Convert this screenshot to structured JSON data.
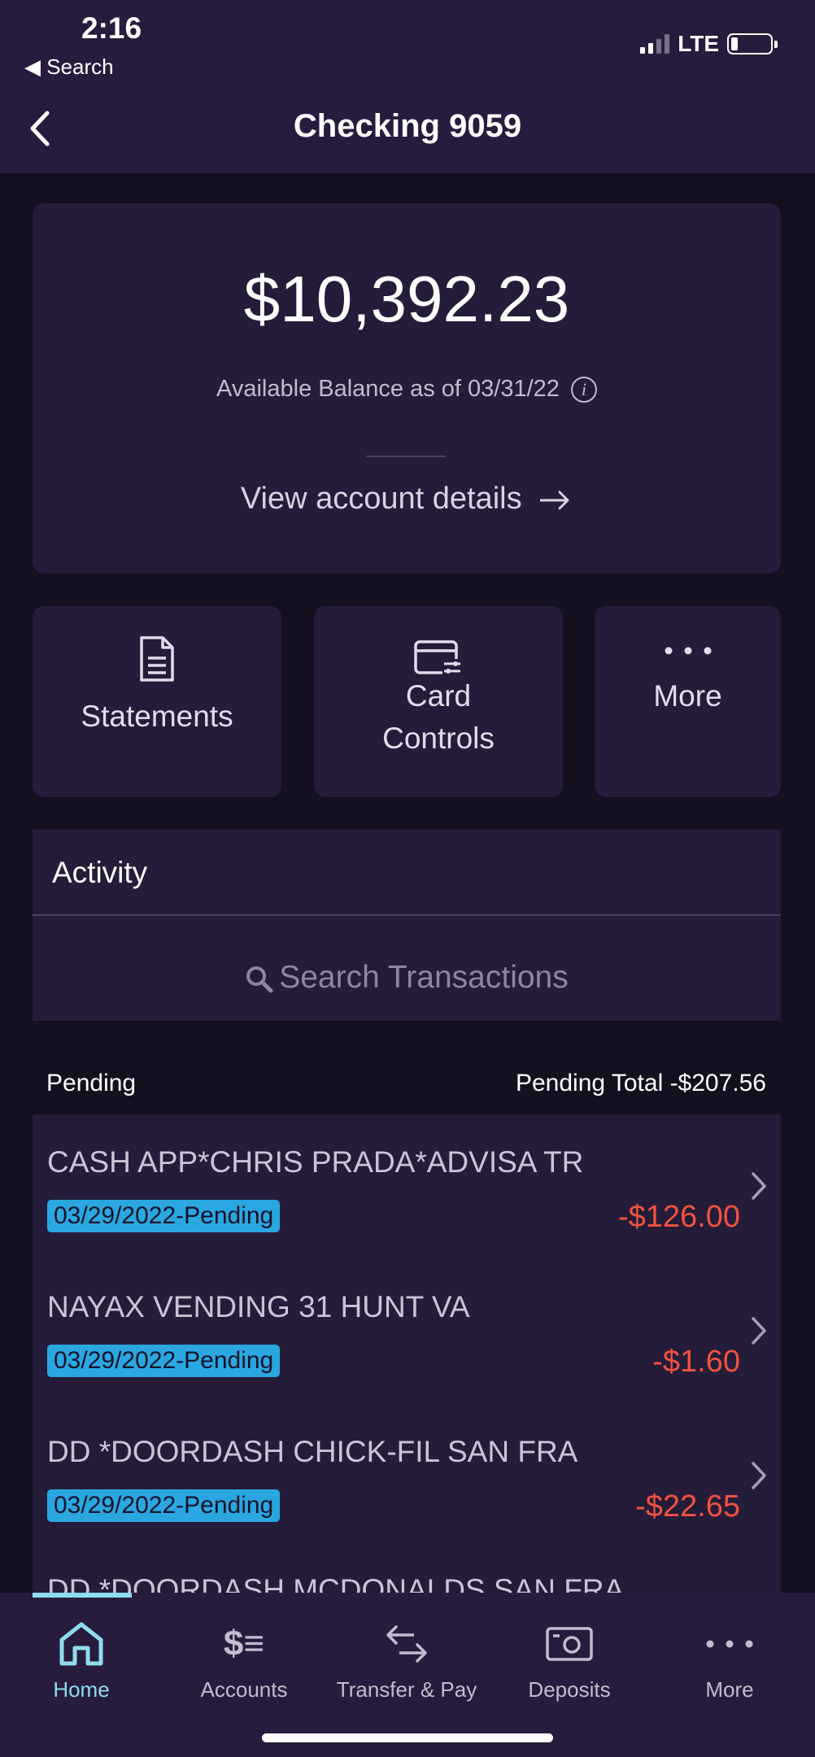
{
  "status_bar": {
    "time": "2:16",
    "back_app": "Search",
    "network": "LTE"
  },
  "nav": {
    "title": "Checking 9059"
  },
  "balance": {
    "amount": "$10,392.23",
    "label": "Available Balance as of 03/31/22",
    "details_link": "View account details"
  },
  "actions": {
    "statements": "Statements",
    "card_controls_line1": "Card",
    "card_controls_line2": "Controls",
    "more": "More"
  },
  "activity": {
    "title": "Activity",
    "search_placeholder": "Search Transactions",
    "pending_label": "Pending",
    "pending_total": "Pending Total -$207.56"
  },
  "transactions": [
    {
      "name": "CASH APP*CHRIS PRADA*ADVISA TR",
      "date": "03/29/2022-Pending",
      "amount": "-$126.00"
    },
    {
      "name": "NAYAX VENDING 31 HUNT VA",
      "date": "03/29/2022-Pending",
      "amount": "-$1.60"
    },
    {
      "name": "DD *DOORDASH CHICK-FIL SAN FRA",
      "date": "03/29/2022-Pending",
      "amount": "-$22.65"
    },
    {
      "name": "DD *DOORDASH MCDONALDS SAN FRA"
    }
  ],
  "tabbar": {
    "home": "Home",
    "accounts": "Accounts",
    "transfer_pay": "Transfer & Pay",
    "deposits": "Deposits",
    "more": "More"
  },
  "colors": {
    "background": "#15101f",
    "card": "#251c39",
    "header": "#271c3d",
    "accent": "#8edcf0",
    "pending_badge": "#2aa7e0",
    "debit": "#f0523f"
  }
}
